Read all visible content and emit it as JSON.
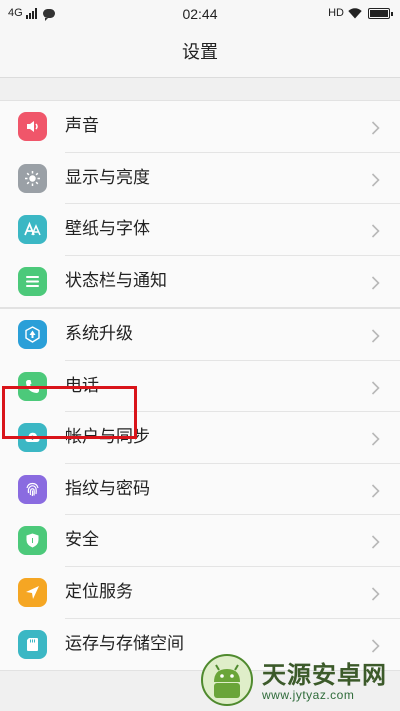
{
  "status_bar": {
    "network": "4G",
    "time": "02:44",
    "hd": "HD"
  },
  "title": "设置",
  "groups": [
    {
      "items": [
        {
          "label": "声音",
          "icon": "speaker-icon",
          "color": "#f0566a"
        },
        {
          "label": "显示与亮度",
          "icon": "brightness-icon",
          "color": "#9aa0a6"
        },
        {
          "label": "壁纸与字体",
          "icon": "font-icon",
          "color": "#3bb7c4"
        },
        {
          "label": "状态栏与通知",
          "icon": "list-icon",
          "color": "#4cc97a"
        }
      ]
    },
    {
      "items": [
        {
          "label": "系统升级",
          "icon": "upgrade-icon",
          "color": "#2a9fd8"
        },
        {
          "label": "电话",
          "icon": "phone-icon",
          "color": "#4cc97a"
        },
        {
          "label": "帐户与同步",
          "icon": "cloud-sync-icon",
          "color": "#3bb7c4"
        },
        {
          "label": "指纹与密码",
          "icon": "fingerprint-icon",
          "color": "#8a6be0"
        },
        {
          "label": "安全",
          "icon": "shield-icon",
          "color": "#4cc97a"
        },
        {
          "label": "定位服务",
          "icon": "location-icon",
          "color": "#f5a623"
        },
        {
          "label": "运存与存储空间",
          "icon": "sd-card-icon",
          "color": "#3bb7c4"
        }
      ]
    }
  ],
  "watermark": {
    "title": "天源安卓网",
    "url": "www.jytyaz.com"
  }
}
